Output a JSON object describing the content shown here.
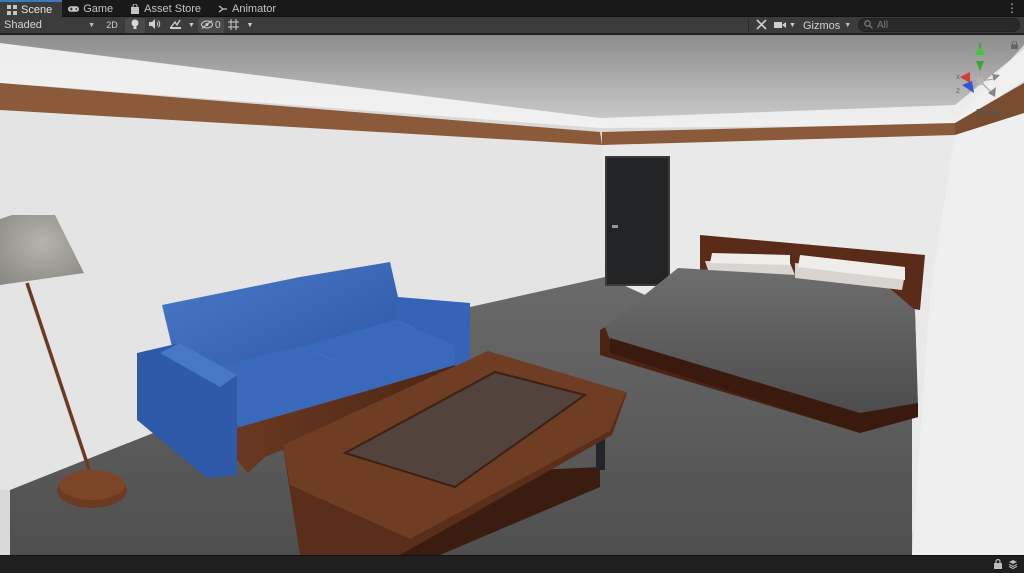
{
  "tabs": [
    {
      "label": "Scene",
      "icon": "grid-icon",
      "active": true
    },
    {
      "label": "Game",
      "icon": "gamepad-icon",
      "active": false
    },
    {
      "label": "Asset Store",
      "icon": "bag-icon",
      "active": false
    },
    {
      "label": "Animator",
      "icon": "animator-icon",
      "active": false
    }
  ],
  "toolbar": {
    "draw_mode": "Shaded",
    "mode_2d": "2D",
    "hidden_count": "0",
    "gizmos": "Gizmos",
    "search_placeholder": "All"
  },
  "viewport": {
    "projection": "Persp",
    "gizmo_axes": [
      "y",
      "x",
      "z"
    ]
  }
}
